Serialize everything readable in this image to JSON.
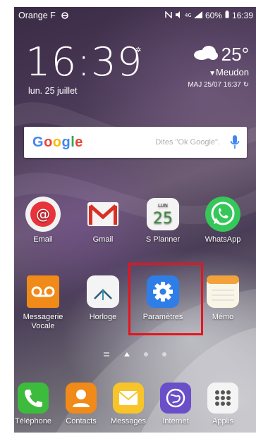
{
  "status": {
    "carrier": "Orange F",
    "battery": "60%",
    "time": "16:39"
  },
  "clock": {
    "time": "16:39",
    "date": "lun. 25 juillet"
  },
  "weather": {
    "temperature": "25°",
    "location": "Meudon",
    "updated": "MAJ 25/07 16:37"
  },
  "search": {
    "brand": "Google",
    "placeholder": "Dites \"Ok Google\"."
  },
  "calendar_icon": {
    "day_abbr": "LUN",
    "day_num": "25"
  },
  "apps_row1": [
    {
      "label": "Email",
      "icon": "email-icon"
    },
    {
      "label": "Gmail",
      "icon": "gmail-icon"
    },
    {
      "label": "S Planner",
      "icon": "calendar-icon"
    },
    {
      "label": "WhatsApp",
      "icon": "whatsapp-icon"
    }
  ],
  "apps_row2": [
    {
      "label": "Messagerie\nVocale",
      "label_line1": "Messagerie",
      "label_line2": "Vocale",
      "icon": "voicemail-icon"
    },
    {
      "label": "Horloge",
      "icon": "clock-icon"
    },
    {
      "label": "Paramètres",
      "icon": "gear-icon",
      "highlighted": true
    },
    {
      "label": "Mémo",
      "icon": "memo-icon"
    }
  ],
  "dock": [
    {
      "label": "Téléphone",
      "icon": "phone-icon"
    },
    {
      "label": "Contacts",
      "icon": "contacts-icon"
    },
    {
      "label": "Messages",
      "icon": "messages-icon"
    },
    {
      "label": "Internet",
      "icon": "internet-icon"
    },
    {
      "label": "Applis",
      "icon": "apps-grid-icon"
    }
  ],
  "colors": {
    "highlight": "#e8141c",
    "settings_icon": "#2f7ee8",
    "whatsapp": "#35c759",
    "voicemail": "#f08a18"
  }
}
